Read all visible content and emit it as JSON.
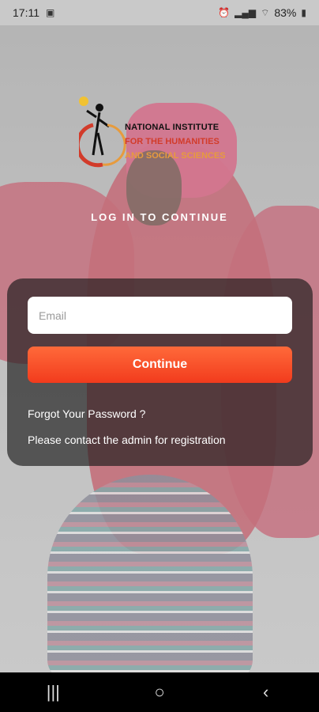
{
  "status_bar": {
    "time": "17:11",
    "battery": "83%",
    "icons": [
      "image-icon",
      "alarm-icon",
      "signal-icon",
      "wifi-icon",
      "battery-icon"
    ]
  },
  "logo": {
    "line1": "NATIONAL INSTITUTE",
    "line2": "FOR THE HUMANITIES",
    "line3": "AND SOCIAL SCIENCES"
  },
  "heading": "LOG IN TO CONTINUE",
  "form": {
    "email_placeholder": "Email",
    "email_value": "",
    "continue_label": "Continue",
    "forgot_password": "Forgot Your Password ?",
    "contact_admin": "Please contact the admin for registration"
  },
  "nav_bar": {
    "recent_apps": "|||",
    "home": "○",
    "back": "‹"
  },
  "colors": {
    "accent": "#f23b1d",
    "card_bg": "rgba(25,25,25,0.65)"
  }
}
